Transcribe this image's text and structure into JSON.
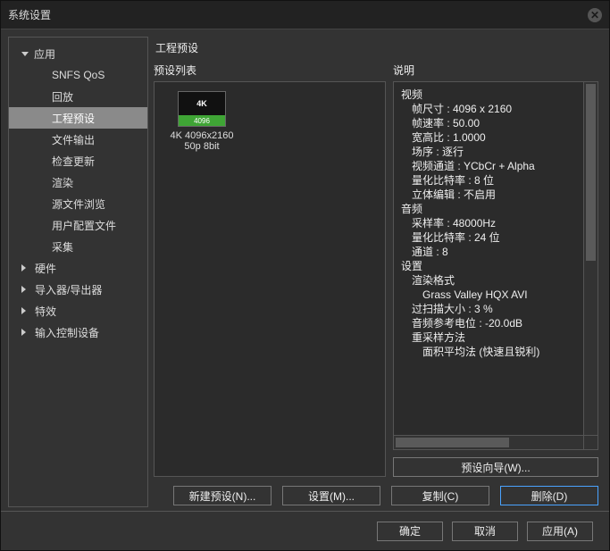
{
  "window": {
    "title": "系统设置"
  },
  "sidebar": {
    "items": [
      {
        "label": "应用",
        "type": "top",
        "expanded": true
      },
      {
        "label": "SNFS QoS",
        "type": "child"
      },
      {
        "label": "回放",
        "type": "child"
      },
      {
        "label": "工程预设",
        "type": "child",
        "selected": true
      },
      {
        "label": "文件输出",
        "type": "child"
      },
      {
        "label": "检查更新",
        "type": "child"
      },
      {
        "label": "渲染",
        "type": "child"
      },
      {
        "label": "源文件浏览",
        "type": "child"
      },
      {
        "label": "用户配置文件",
        "type": "child"
      },
      {
        "label": "采集",
        "type": "child"
      },
      {
        "label": "硬件",
        "type": "top",
        "expanded": false
      },
      {
        "label": "导入器/导出器",
        "type": "top",
        "expanded": false
      },
      {
        "label": "特效",
        "type": "top",
        "expanded": false
      },
      {
        "label": "输入控制设备",
        "type": "top",
        "expanded": false
      }
    ]
  },
  "main": {
    "section_title": "工程预设",
    "preset_list_label": "预设列表",
    "description_label": "说明",
    "preset": {
      "badge_top": "4K",
      "badge_bottom": "4096",
      "name_line1": "4K 4096x2160",
      "name_line2": "50p 8bit"
    },
    "description_lines": [
      {
        "cls": "ind1",
        "text": "视频"
      },
      {
        "cls": "ind2",
        "text": "帧尺寸 : 4096 x 2160"
      },
      {
        "cls": "ind2",
        "text": "帧速率 : 50.00"
      },
      {
        "cls": "ind2",
        "text": "宽高比 : 1.0000"
      },
      {
        "cls": "ind2",
        "text": "场序 : 逐行"
      },
      {
        "cls": "ind2",
        "text": "视频通道 : YCbCr + Alpha"
      },
      {
        "cls": "ind2",
        "text": "量化比特率 : 8 位"
      },
      {
        "cls": "ind2",
        "text": "立体编辑 : 不启用"
      },
      {
        "cls": "ind1",
        "text": "音频"
      },
      {
        "cls": "ind2",
        "text": "采样率 : 48000Hz"
      },
      {
        "cls": "ind2",
        "text": "量化比特率 : 24 位"
      },
      {
        "cls": "ind2",
        "text": "通道 : 8"
      },
      {
        "cls": "ind1",
        "text": "设置"
      },
      {
        "cls": "ind2",
        "text": "渲染格式"
      },
      {
        "cls": "ind3",
        "text": "Grass Valley HQX AVI"
      },
      {
        "cls": "ind2",
        "text": "过扫描大小 : 3 %"
      },
      {
        "cls": "ind2",
        "text": "音频参考电位 : -20.0dB"
      },
      {
        "cls": "ind2",
        "text": "重采样方法"
      },
      {
        "cls": "ind3",
        "text": "面积平均法 (快速且锐利)"
      }
    ],
    "wizard_button": "预设向导(W)...",
    "buttons": {
      "new_preset": "新建预设(N)...",
      "settings": "设置(M)...",
      "copy": "复制(C)",
      "delete": "删除(D)"
    }
  },
  "footer": {
    "ok": "确定",
    "cancel": "取消",
    "apply": "应用(A)"
  }
}
